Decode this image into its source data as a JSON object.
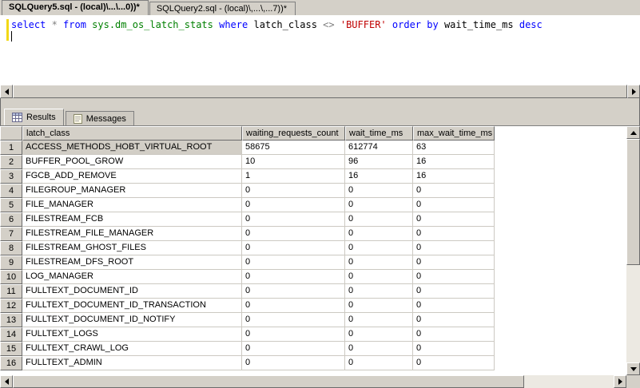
{
  "window": {
    "doc_tabs": [
      {
        "label": "SQLQuery5.sql - (local)\\...\\...0))*",
        "active": true
      },
      {
        "label": "SQLQuery2.sql - (local)\\,...\\,...7))*",
        "active": false
      }
    ]
  },
  "editor": {
    "sql_text": "select * from sys.dm_os_latch_stats where latch_class <> 'BUFFER' order by wait_time_ms desc",
    "tokens": [
      {
        "t": "select ",
        "c": "kw"
      },
      {
        "t": "* ",
        "c": "op"
      },
      {
        "t": "from ",
        "c": "kw"
      },
      {
        "t": "sys.dm_os_latch_stats ",
        "c": "sys"
      },
      {
        "t": "where ",
        "c": "kw"
      },
      {
        "t": "latch_class ",
        "c": "id"
      },
      {
        "t": "<> ",
        "c": "op"
      },
      {
        "t": "'BUFFER' ",
        "c": "str"
      },
      {
        "t": "order ",
        "c": "kw"
      },
      {
        "t": "by ",
        "c": "kw"
      },
      {
        "t": "wait_time_ms ",
        "c": "id"
      },
      {
        "t": "desc",
        "c": "kw"
      }
    ]
  },
  "results_pane": {
    "tabs": [
      {
        "label": "Results",
        "active": true
      },
      {
        "label": "Messages",
        "active": false
      }
    ]
  },
  "grid": {
    "columns": [
      "",
      "latch_class",
      "waiting_requests_count",
      "wait_time_ms",
      "max_wait_time_ms"
    ],
    "selected": {
      "row": 1,
      "column": "latch_class"
    },
    "rows": [
      {
        "num": 1,
        "latch_class": "ACCESS_METHODS_HOBT_VIRTUAL_ROOT",
        "waiting_requests_count": 58675,
        "wait_time_ms": 612774,
        "max_wait_time_ms": 63
      },
      {
        "num": 2,
        "latch_class": "BUFFER_POOL_GROW",
        "waiting_requests_count": 10,
        "wait_time_ms": 96,
        "max_wait_time_ms": 16
      },
      {
        "num": 3,
        "latch_class": "FGCB_ADD_REMOVE",
        "waiting_requests_count": 1,
        "wait_time_ms": 16,
        "max_wait_time_ms": 16
      },
      {
        "num": 4,
        "latch_class": "FILEGROUP_MANAGER",
        "waiting_requests_count": 0,
        "wait_time_ms": 0,
        "max_wait_time_ms": 0
      },
      {
        "num": 5,
        "latch_class": "FILE_MANAGER",
        "waiting_requests_count": 0,
        "wait_time_ms": 0,
        "max_wait_time_ms": 0
      },
      {
        "num": 6,
        "latch_class": "FILESTREAM_FCB",
        "waiting_requests_count": 0,
        "wait_time_ms": 0,
        "max_wait_time_ms": 0
      },
      {
        "num": 7,
        "latch_class": "FILESTREAM_FILE_MANAGER",
        "waiting_requests_count": 0,
        "wait_time_ms": 0,
        "max_wait_time_ms": 0
      },
      {
        "num": 8,
        "latch_class": "FILESTREAM_GHOST_FILES",
        "waiting_requests_count": 0,
        "wait_time_ms": 0,
        "max_wait_time_ms": 0
      },
      {
        "num": 9,
        "latch_class": "FILESTREAM_DFS_ROOT",
        "waiting_requests_count": 0,
        "wait_time_ms": 0,
        "max_wait_time_ms": 0
      },
      {
        "num": 10,
        "latch_class": "LOG_MANAGER",
        "waiting_requests_count": 0,
        "wait_time_ms": 0,
        "max_wait_time_ms": 0
      },
      {
        "num": 11,
        "latch_class": "FULLTEXT_DOCUMENT_ID",
        "waiting_requests_count": 0,
        "wait_time_ms": 0,
        "max_wait_time_ms": 0
      },
      {
        "num": 12,
        "latch_class": "FULLTEXT_DOCUMENT_ID_TRANSACTION",
        "waiting_requests_count": 0,
        "wait_time_ms": 0,
        "max_wait_time_ms": 0
      },
      {
        "num": 13,
        "latch_class": "FULLTEXT_DOCUMENT_ID_NOTIFY",
        "waiting_requests_count": 0,
        "wait_time_ms": 0,
        "max_wait_time_ms": 0
      },
      {
        "num": 14,
        "latch_class": "FULLTEXT_LOGS",
        "waiting_requests_count": 0,
        "wait_time_ms": 0,
        "max_wait_time_ms": 0
      },
      {
        "num": 15,
        "latch_class": "FULLTEXT_CRAWL_LOG",
        "waiting_requests_count": 0,
        "wait_time_ms": 0,
        "max_wait_time_ms": 0
      },
      {
        "num": 16,
        "latch_class": "FULLTEXT_ADMIN",
        "waiting_requests_count": 0,
        "wait_time_ms": 0,
        "max_wait_time_ms": 0
      }
    ]
  },
  "colors": {
    "chrome_face": "#d4d0c8",
    "keyword": "#0000ff",
    "system_object": "#008000",
    "string_literal": "#c00000",
    "operator": "#7f7f7f",
    "change_bar": "#f2d816",
    "selected_cell": "#d2cec6"
  }
}
